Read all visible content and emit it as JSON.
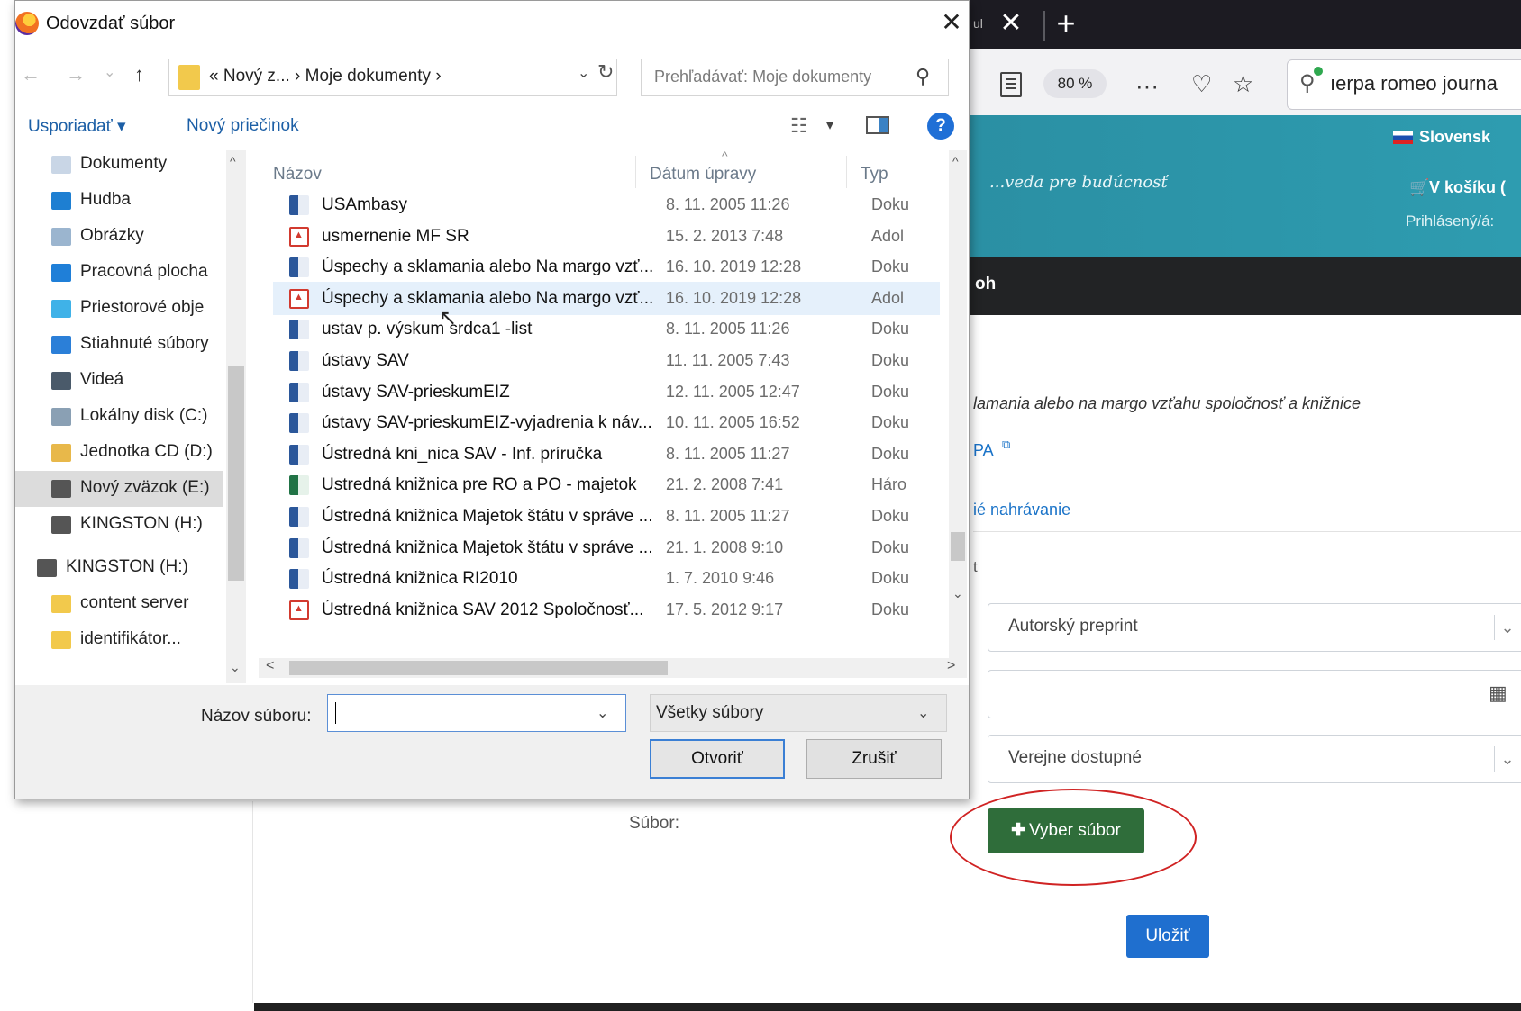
{
  "dialog": {
    "title": "Odovzdať súbor",
    "close_glyph": "✕",
    "nav": {
      "back": "←",
      "forward": "→",
      "recent": "⌄",
      "up": "↑"
    },
    "path": "« Nový z...  ›  Moje dokumenty  ›",
    "path_caret": "⌄",
    "refresh_glyph": "↻",
    "search_placeholder": "Prehľadávať: Moje dokumenty",
    "search_glyph": "⚲",
    "toolbar": {
      "organize": "Usporiadať ▾",
      "new_folder": "Nový priečinok",
      "view_glyph": "☷",
      "view_caret": "▾",
      "help": "?"
    },
    "nav_items": [
      {
        "label": "Dokumenty",
        "icon": "documents-icon",
        "color": "#c9d6e6"
      },
      {
        "label": "Hudba",
        "icon": "music-icon",
        "color": "#1e7fd2"
      },
      {
        "label": "Obrázky",
        "icon": "pictures-icon",
        "color": "#9bb5cf"
      },
      {
        "label": "Pracovná plocha",
        "icon": "desktop-icon",
        "color": "#1f7fd8"
      },
      {
        "label": "Priestorové obje",
        "icon": "3d-objects-icon",
        "color": "#3fb2e8"
      },
      {
        "label": "Stiahnuté súbory",
        "icon": "downloads-icon",
        "color": "#2b7fd8"
      },
      {
        "label": "Videá",
        "icon": "videos-icon",
        "color": "#4a5a6a"
      },
      {
        "label": "Lokálny disk (C:)",
        "icon": "local-disk-icon",
        "color": "#8aa0b4"
      },
      {
        "label": "Jednotka CD (D:)",
        "icon": "cd-drive-icon",
        "color": "#e8b84a"
      },
      {
        "label": "Nový zväzok (E:)",
        "icon": "drive-icon",
        "color": "#555555"
      },
      {
        "label": "KINGSTON (H:)",
        "icon": "usb-drive-icon",
        "color": "#555555"
      },
      {
        "label": "KINGSTON (H:)",
        "icon": "usb-drive-icon",
        "color": "#555555"
      },
      {
        "label": "content server",
        "icon": "folder-icon",
        "color": "#f2c94c"
      },
      {
        "label": "identifikátor...",
        "icon": "folder-icon",
        "color": "#f2c94c"
      }
    ],
    "columns": {
      "name": "Názov",
      "date": "Dátum úpravy",
      "type": "Typ"
    },
    "sort_glyph": "^",
    "files": [
      {
        "name": "USAmbasy",
        "date": "8. 11. 2005 11:26",
        "type": "Doku",
        "kind": "word"
      },
      {
        "name": "usmernenie MF SR",
        "date": "15. 2. 2013 7:48",
        "type": "Adol",
        "kind": "pdf"
      },
      {
        "name": "Úspechy a sklamania alebo Na margo vzť...",
        "date": "16. 10. 2019 12:28",
        "type": "Doku",
        "kind": "word"
      },
      {
        "name": "Úspechy a sklamania alebo Na margo vzť...",
        "date": "16. 10. 2019 12:28",
        "type": "Adol",
        "kind": "pdf"
      },
      {
        "name": "ustav p. výskum srdca1 -list",
        "date": "8. 11. 2005 11:26",
        "type": "Doku",
        "kind": "word"
      },
      {
        "name": "ústavy SAV",
        "date": "11. 11. 2005 7:43",
        "type": "Doku",
        "kind": "word"
      },
      {
        "name": "ústavy SAV-prieskumEIZ",
        "date": "12. 11. 2005 12:47",
        "type": "Doku",
        "kind": "word"
      },
      {
        "name": "ústavy SAV-prieskumEIZ-vyjadrenia k náv...",
        "date": "10. 11. 2005 16:52",
        "type": "Doku",
        "kind": "word"
      },
      {
        "name": "Ústredná kni_nica SAV - Inf. príručka",
        "date": "8. 11. 2005 11:27",
        "type": "Doku",
        "kind": "word"
      },
      {
        "name": "Ustredná knižnica  pre RO a PO - majetok",
        "date": "21. 2. 2008 7:41",
        "type": "Háro",
        "kind": "excel"
      },
      {
        "name": "Ústredná knižnica Majetok štátu v správe ...",
        "date": "8. 11. 2005 11:27",
        "type": "Doku",
        "kind": "word"
      },
      {
        "name": "Ústredná knižnica Majetok štátu v správe ...",
        "date": "21. 1. 2008 9:10",
        "type": "Doku",
        "kind": "word"
      },
      {
        "name": "Ústredná knižnica RI2010",
        "date": "1. 7. 2010 9:46",
        "type": "Doku",
        "kind": "word"
      },
      {
        "name": "Ústredná knižnica SAV 2012 Spoločnosť...",
        "date": "17. 5. 2012 9:17",
        "type": "Doku",
        "kind": "pdf"
      }
    ],
    "hovered_row": 3,
    "filename_label": "Názov súboru:",
    "filename_value": "",
    "filter_value": "Všetky súbory",
    "open_button": "Otvoriť",
    "cancel_button": "Zrušiť",
    "cursor_glyph": "↖",
    "scroll_up_glyph": "^",
    "scroll_down_glyph": "⌄",
    "hscroll_left_glyph": "<",
    "hscroll_right_glyph": ">"
  },
  "browser": {
    "tab_fragment": "ul",
    "tab_close_glyph": "✕",
    "new_tab_glyph": "+",
    "zoom": "80 %",
    "overflow_glyph": "···",
    "pocket_glyph": "♡",
    "bookmark_glyph": "☆",
    "url_glyph": "⚲",
    "url_text": "ıerpa romeo journa"
  },
  "site": {
    "tagline": "...veda pre budúcnosť",
    "language": "Slovensk",
    "cart": "V košíku (",
    "cart_glyph": "🛒",
    "login": "Prihlásený/á:",
    "nav_text": "oh",
    "description": "lamania alebo na margo vzťahu spoločnosť a knižnice",
    "link_frag": "PA",
    "ext_glyph": "⧉",
    "upload_link": "ié nahrávanie",
    "field_frag": "t",
    "version_select": "Autorský preprint",
    "calendar_glyph": "▦",
    "access_select": "Verejne dostupné",
    "select_caret": "⌄",
    "file_label": "Súbor:",
    "pick_file_button": "Vyber súbor",
    "pick_file_plus": "✚",
    "save_button": "Uložiť",
    "colors": {
      "header": "#2e9cb0",
      "nav": "#222325",
      "pick_button": "#2f6d3a",
      "save_button": "#1f6fcf",
      "highlight_circle": "#d02323"
    }
  }
}
